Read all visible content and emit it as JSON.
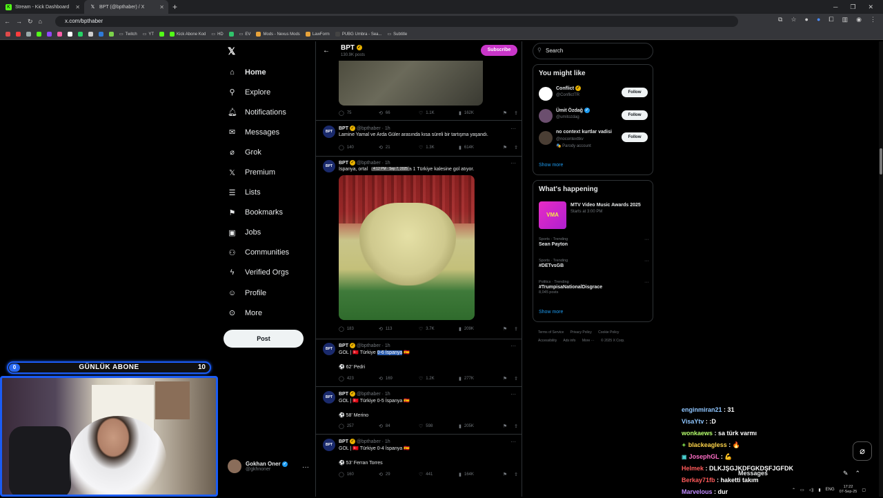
{
  "browser": {
    "tabs": [
      {
        "title": "Stream - Kick Dashboard",
        "icon": "kick-icon",
        "active": false
      },
      {
        "title": "BPT (@bpthaber) / X",
        "icon": "x-icon",
        "active": true
      }
    ],
    "url": "x.com/bpthaber",
    "bookmarks": [
      "Twitch",
      "YT",
      "Kick Abone Kod",
      "HD",
      "EV",
      "Mods - Nexus Mods",
      "LawForm",
      "PUBG Umbra - Sea...",
      "Subtitle"
    ]
  },
  "sidebar": {
    "items": [
      {
        "label": "Home",
        "icon": "home-icon"
      },
      {
        "label": "Explore",
        "icon": "search-icon"
      },
      {
        "label": "Notifications",
        "icon": "bell-icon"
      },
      {
        "label": "Messages",
        "icon": "mail-icon"
      },
      {
        "label": "Grok",
        "icon": "grok-icon"
      },
      {
        "label": "Premium",
        "icon": "x-icon"
      },
      {
        "label": "Lists",
        "icon": "list-icon"
      },
      {
        "label": "Bookmarks",
        "icon": "bookmark-icon"
      },
      {
        "label": "Jobs",
        "icon": "briefcase-icon"
      },
      {
        "label": "Communities",
        "icon": "people-icon"
      },
      {
        "label": "Verified Orgs",
        "icon": "lightning-icon"
      },
      {
        "label": "Profile",
        "icon": "person-icon"
      },
      {
        "label": "More",
        "icon": "more-circle-icon"
      }
    ],
    "post_label": "Post",
    "account": {
      "name": "Gokhan Oner",
      "handle": "@gkhnoner"
    }
  },
  "profile_header": {
    "name": "BPT",
    "posts": "130.9K posts",
    "subscribe_label": "Subscribe"
  },
  "first_actions": {
    "replies": "75",
    "reposts": "66",
    "likes": "1.1K",
    "views": "162K"
  },
  "tweets": [
    {
      "author": "BPT",
      "handle": "@bpthaber",
      "time": "1h",
      "text": "Lamine Yamal ve Arda Güler arasında kısa süreli bir tartışma yaşandı.",
      "replies": "140",
      "reposts": "21",
      "likes": "1.3K",
      "views": "614K"
    },
    {
      "author": "BPT",
      "handle": "@bpthaber",
      "time": "1h",
      "text_before": "İspanya, ortal",
      "tooltip": "4:12 PM · Sep 7, 2025",
      "text_after": "ada 1 Türkiye kalesine gol atıyor.",
      "replies": "183",
      "reposts": "113",
      "likes": "3.7K",
      "views": "209K"
    },
    {
      "author": "BPT",
      "handle": "@bpthaber",
      "time": "1h",
      "text_prefix": "GOL | 🇹🇷 Türkiye ",
      "score": "0-6 İspanya",
      "flag_suffix": "🇪🇸",
      "scorer": "⚽ 62' Pedri",
      "replies": "423",
      "reposts": "169",
      "likes": "1.2K",
      "views": "277K"
    },
    {
      "author": "BPT",
      "handle": "@bpthaber",
      "time": "1h",
      "text": "GOL | 🇹🇷 Türkiye 0-5 İspanya 🇪🇸",
      "scorer": "⚽ 58' Merino",
      "replies": "257",
      "reposts": "84",
      "likes": "598",
      "views": "205K"
    },
    {
      "author": "BPT",
      "handle": "@bpthaber",
      "time": "1h",
      "text": "GOL | 🇹🇷 Türkiye 0-4 İspanya 🇪🇸",
      "scorer": "⚽ 53' Ferran Torres",
      "replies": "160",
      "reposts": "29",
      "likes": "441",
      "views": "164K"
    }
  ],
  "right": {
    "search_placeholder": "Search",
    "might_like_title": "You might like",
    "suggestions": [
      {
        "name": "Conflict",
        "handle": "@ConflictTR",
        "follow": "Follow",
        "color": "#ffffff"
      },
      {
        "name": "Ümit Özdağ",
        "handle": "@umitozdag",
        "follow": "Follow",
        "color": "#6b4e6e"
      },
      {
        "name": "no context kurtlar vadisi",
        "handle": "@nocontexttkv",
        "parody": "🎭 Parody account",
        "follow": "Follow",
        "color": "#4a3e34"
      }
    ],
    "show_more": "Show more",
    "happening_title": "What's happening",
    "event": {
      "image_text": "VMA",
      "title": "MTV Video Music Awards 2025",
      "subtitle": "Starts at 3:00 PM"
    },
    "trends": [
      {
        "category": "Sports · Trending",
        "name": "Sean Payton",
        "count": ""
      },
      {
        "category": "Sports · Trending",
        "name": "#DETvsGB",
        "count": ""
      },
      {
        "category": "Politics · Trending",
        "name": "#TrumpisaNationalDisgrace",
        "count": "8,045 posts"
      }
    ],
    "footer": [
      "Terms of Service",
      "Privacy Policy",
      "Cookie Policy",
      "Accessibility",
      "Ads info",
      "More ···",
      "© 2025 X Corp."
    ]
  },
  "overlay": {
    "sub_current": "0",
    "sub_label": "GÜNLÜK ABONE",
    "sub_target": "10",
    "chat": [
      {
        "user": "enginmiran21",
        "color": "#8fc6ff",
        "msg": "31",
        "badge": ""
      },
      {
        "user": "VisaYtv",
        "color": "#8fc6ff",
        "msg": ":D",
        "badge": ""
      },
      {
        "user": "wonkaews",
        "color": "#b6ff6e",
        "msg": "sa türk varmı",
        "badge": ""
      },
      {
        "user": "blackeagless",
        "color": "#ffd54a",
        "msg": "🔥",
        "badge": "✦"
      },
      {
        "user": "JosephGL",
        "color": "#ff6ec7",
        "msg": "💪",
        "badge": "▣"
      },
      {
        "user": "Helmek",
        "color": "#ff5a5a",
        "msg": "DLKJŞGJKDFGKDŞFJGFDK",
        "badge": ""
      },
      {
        "user": "Berkay71fb",
        "color": "#ff5a5a",
        "msg": "haketti takım",
        "badge": ""
      },
      {
        "user": "Marvelous",
        "color": "#c18cff",
        "msg": "dur",
        "badge": ""
      }
    ],
    "messages_label": "Messages"
  },
  "taskbar": {
    "lang": "ENG",
    "time": "17:22",
    "date": "07-Sep-25"
  }
}
